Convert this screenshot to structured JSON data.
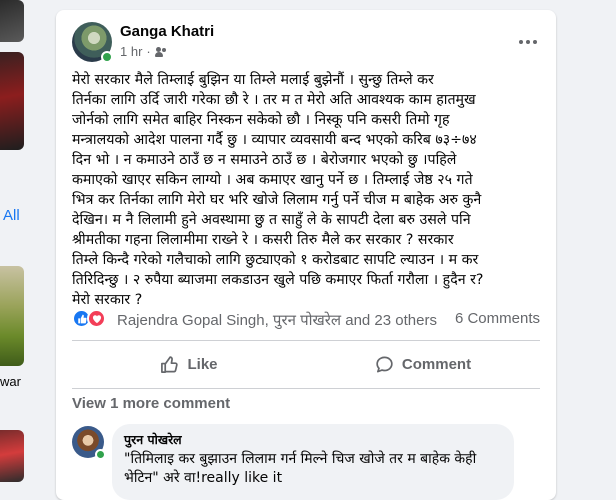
{
  "sidebar": {
    "all_link": "All",
    "partial_name": "war"
  },
  "post": {
    "author": "Ganga Khatri",
    "time": "1 hr",
    "privacy_icon": "friends-icon",
    "text": "मेरो सरकार मैले तिम्लाई बुझिन या तिम्ले मलाई बुझेनौं । सुन्छु तिम्ले कर\nतिर्नका लागि उर्दि जारी गरेका छौ रे । तर म त मेरो अति आवश्यक काम हातमुख\nजोर्नको लागि समेत बाहिर निस्कन सकेको छौ । निस्कू पनि कसरी तिमो गृह\nमन्त्रालयको आदेश पालना गर्दै छु । व्यापार व्यवसायी बन्द भएको करिब ७३÷७४\nदिन भो । न कमाउने ठाउँ छ न समाउने ठाउँ छ । बेरोजगार भएको छु ।पहिले\nकमाएको खाएर सकिन लाग्यो । अब कमाएर खानु पर्ने छ । तिम्लाई जेष्ठ २५ गते\nभित्र कर तिर्नका लागि मेरो घर भरि खोजे लिलाम गर्नु पर्ने चीज म बाहेक अरु कुनै\nदेखिन। म  नै लिलामी हुने अवस्थामा छु त साहुँ ले के सापटी देला बरु उसले पनि\nश्रीमतीका गहना लिलामीमा राख्ने रे ।  कसरी तिरु मैले कर सरकार ? सरकार\nतिम्ले किन्दै गरेको गलैचाको लागि छुट्याएको १ करोडबाट सापटि ल्याउन । म कर\nतिरिदिन्छु । २ रुपैया ब्याजमा लकडाउन खुले पछि कमाएर फिर्ता गरौला । हुदैन र?\nमेरो सरकार ?"
  },
  "reactions": {
    "names": "Rajendra Gopal Singh, पुरन पोखरेल and 23 others",
    "comments_count": "6 Comments"
  },
  "actions": {
    "like": "Like",
    "comment": "Comment"
  },
  "view_more": "View 1 more comment",
  "comment": {
    "author": "पुरन पोखरेल",
    "text": "\"तिमिलाइ कर बुझाउन लिलाम गर्न मिल्ने चिज खोजे तर म बाहेक केही भेटिन\" अरे वा!really like it"
  },
  "colors": {
    "like_blue": "#1877f2",
    "love_red": "#f33e58",
    "online_green": "#31a24c",
    "secondary_text": "#65676b"
  }
}
